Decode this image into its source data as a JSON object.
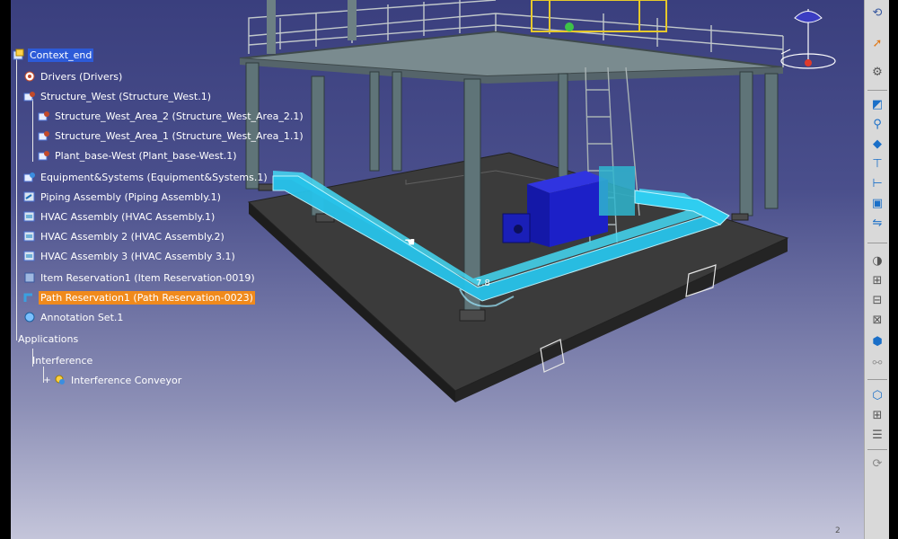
{
  "tree": {
    "root": "Context_end",
    "items": [
      {
        "label": "Drivers (Drivers)"
      },
      {
        "label": "Structure_West (Structure_West.1)"
      },
      {
        "label": "Structure_West_Area_2 (Structure_West_Area_2.1)"
      },
      {
        "label": "Structure_West_Area_1 (Structure_West_Area_1.1)"
      },
      {
        "label": "Plant_base-West (Plant_base-West.1)"
      },
      {
        "label": "Equipment&Systems (Equipment&Systems.1)"
      },
      {
        "label": "Piping Assembly (Piping Assembly.1)"
      },
      {
        "label": "HVAC Assembly (HVAC Assembly.1)"
      },
      {
        "label": "HVAC Assembly 2 (HVAC Assembly.2)"
      },
      {
        "label": "HVAC Assembly 3 (HVAC Assembly 3.1)"
      },
      {
        "label": "Item Reservation1 (Item Reservation-0019)"
      },
      {
        "label": "Path Reservation1 (Path Reservation-0023)"
      },
      {
        "label": "Annotation Set.1"
      },
      {
        "label": "Applications"
      },
      {
        "label": "Interference"
      },
      {
        "label": "Interference Conveyor"
      }
    ]
  },
  "viewport": {
    "dimension_label": "7.8",
    "page_indicator": "2"
  },
  "toolbar": {
    "buttons": [
      "fly-mode-icon",
      "select-icon",
      "rotate-icon",
      "fit-all-icon",
      "pan-icon",
      "normal-view-icon",
      "iso-view-icon",
      "multi-view-icon",
      "hide-show-icon",
      "swap-icon",
      "shading-icon",
      "measure-icon",
      "section-icon",
      "clash-icon",
      "link-icon",
      "catalog-icon",
      "tools-palette-icon",
      "grid-icon",
      "update-icon"
    ]
  },
  "colors": {
    "selection_blue": "#2d5bd8",
    "selection_orange": "#f08a1c",
    "duct_cyan": "#34d3f2",
    "equipment_blue": "#1a1fc8",
    "slab_gray": "#3a3a3a",
    "steel_gray": "#6d7f82"
  }
}
